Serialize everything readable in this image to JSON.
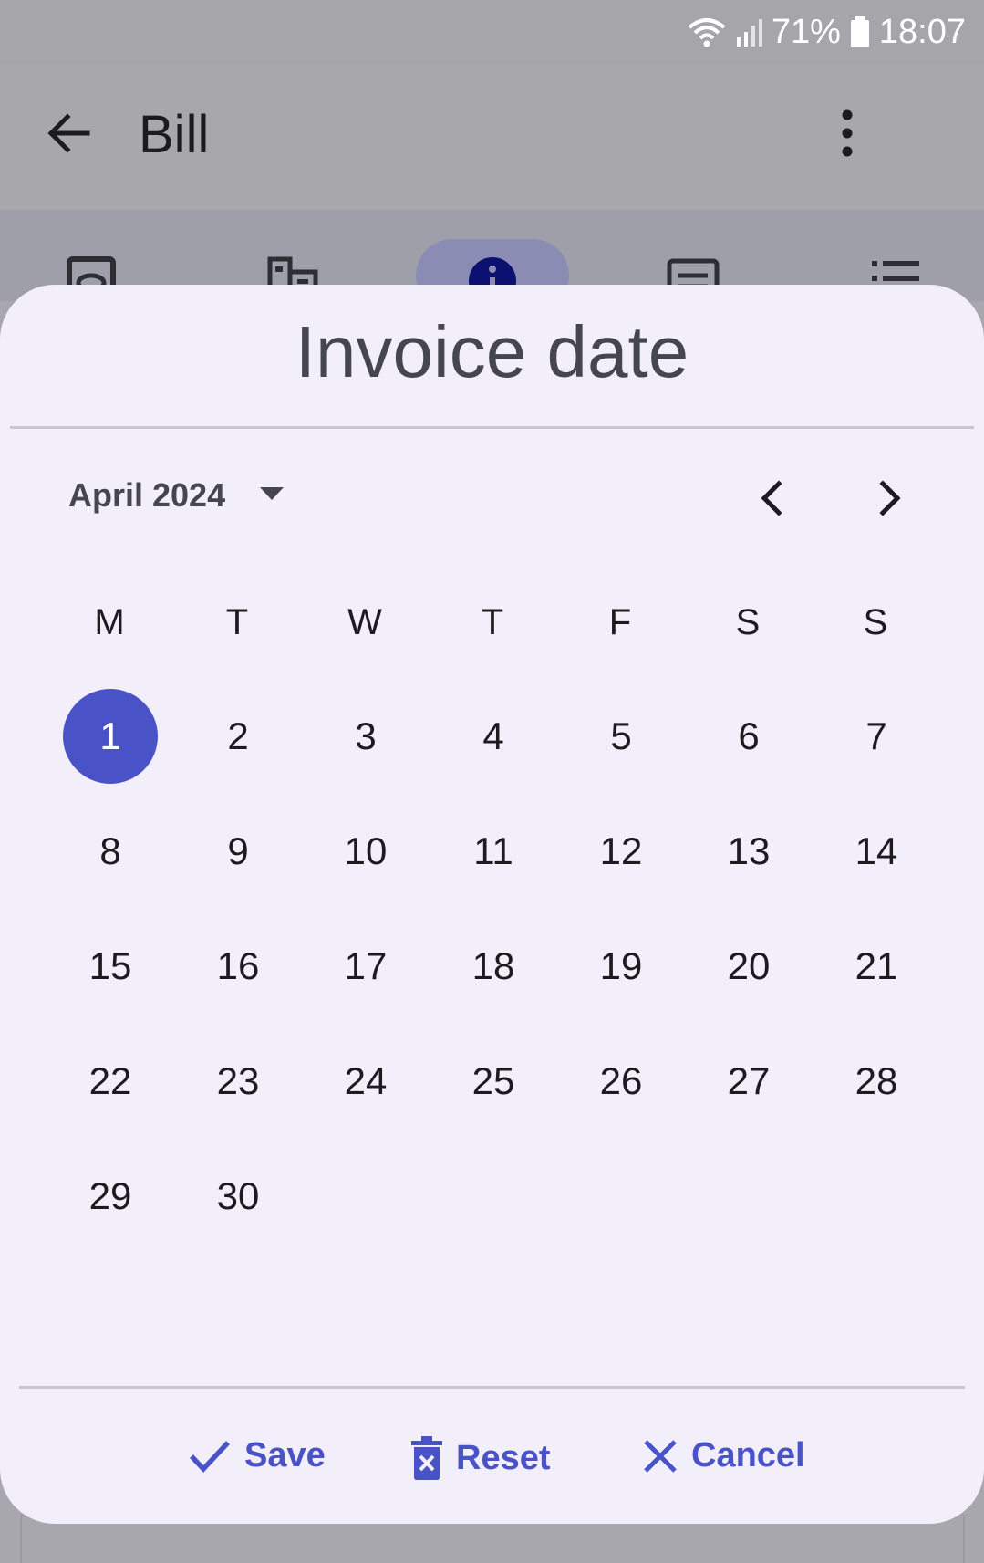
{
  "status_bar": {
    "battery": "71%",
    "time": "18:07"
  },
  "app_bar": {
    "title": "Bill"
  },
  "dialog": {
    "title": "Invoice date",
    "month_year": "April 2024",
    "weekdays": [
      "M",
      "T",
      "W",
      "T",
      "F",
      "S",
      "S"
    ],
    "weeks": [
      [
        "1",
        "2",
        "3",
        "4",
        "5",
        "6",
        "7"
      ],
      [
        "8",
        "9",
        "10",
        "11",
        "12",
        "13",
        "14"
      ],
      [
        "15",
        "16",
        "17",
        "18",
        "19",
        "20",
        "21"
      ],
      [
        "22",
        "23",
        "24",
        "25",
        "26",
        "27",
        "28"
      ],
      [
        "29",
        "30"
      ]
    ],
    "selected_day": "1",
    "actions": {
      "save": "Save",
      "reset": "Reset",
      "cancel": "Cancel"
    }
  },
  "colors": {
    "accent": "#4a52c8",
    "dialog_bg": "#f2effa",
    "scrim": "#a8a7ad"
  }
}
